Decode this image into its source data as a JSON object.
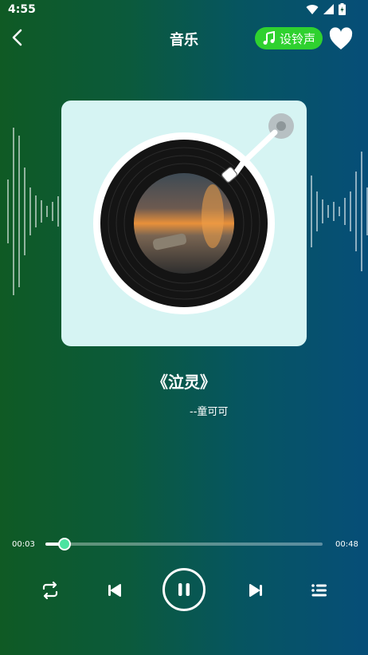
{
  "status_bar": {
    "time": "4:55"
  },
  "header": {
    "title": "音乐",
    "ringtone_label": "设铃声"
  },
  "song": {
    "title": "《泣灵》",
    "artist": "--童可可"
  },
  "progress": {
    "current": "00:03",
    "total": "00:48",
    "fraction": 0.07
  },
  "colors": {
    "accent_green": "#2fd12f",
    "knob": "#4be3a0",
    "card_bg": "#d6f4f3"
  },
  "icons": {
    "back": "chevron-left-icon",
    "favorite": "heart-icon",
    "repeat": "repeat-icon",
    "previous": "skip-previous-icon",
    "pause": "pause-icon",
    "next": "skip-next-icon",
    "playlist": "playlist-icon"
  }
}
